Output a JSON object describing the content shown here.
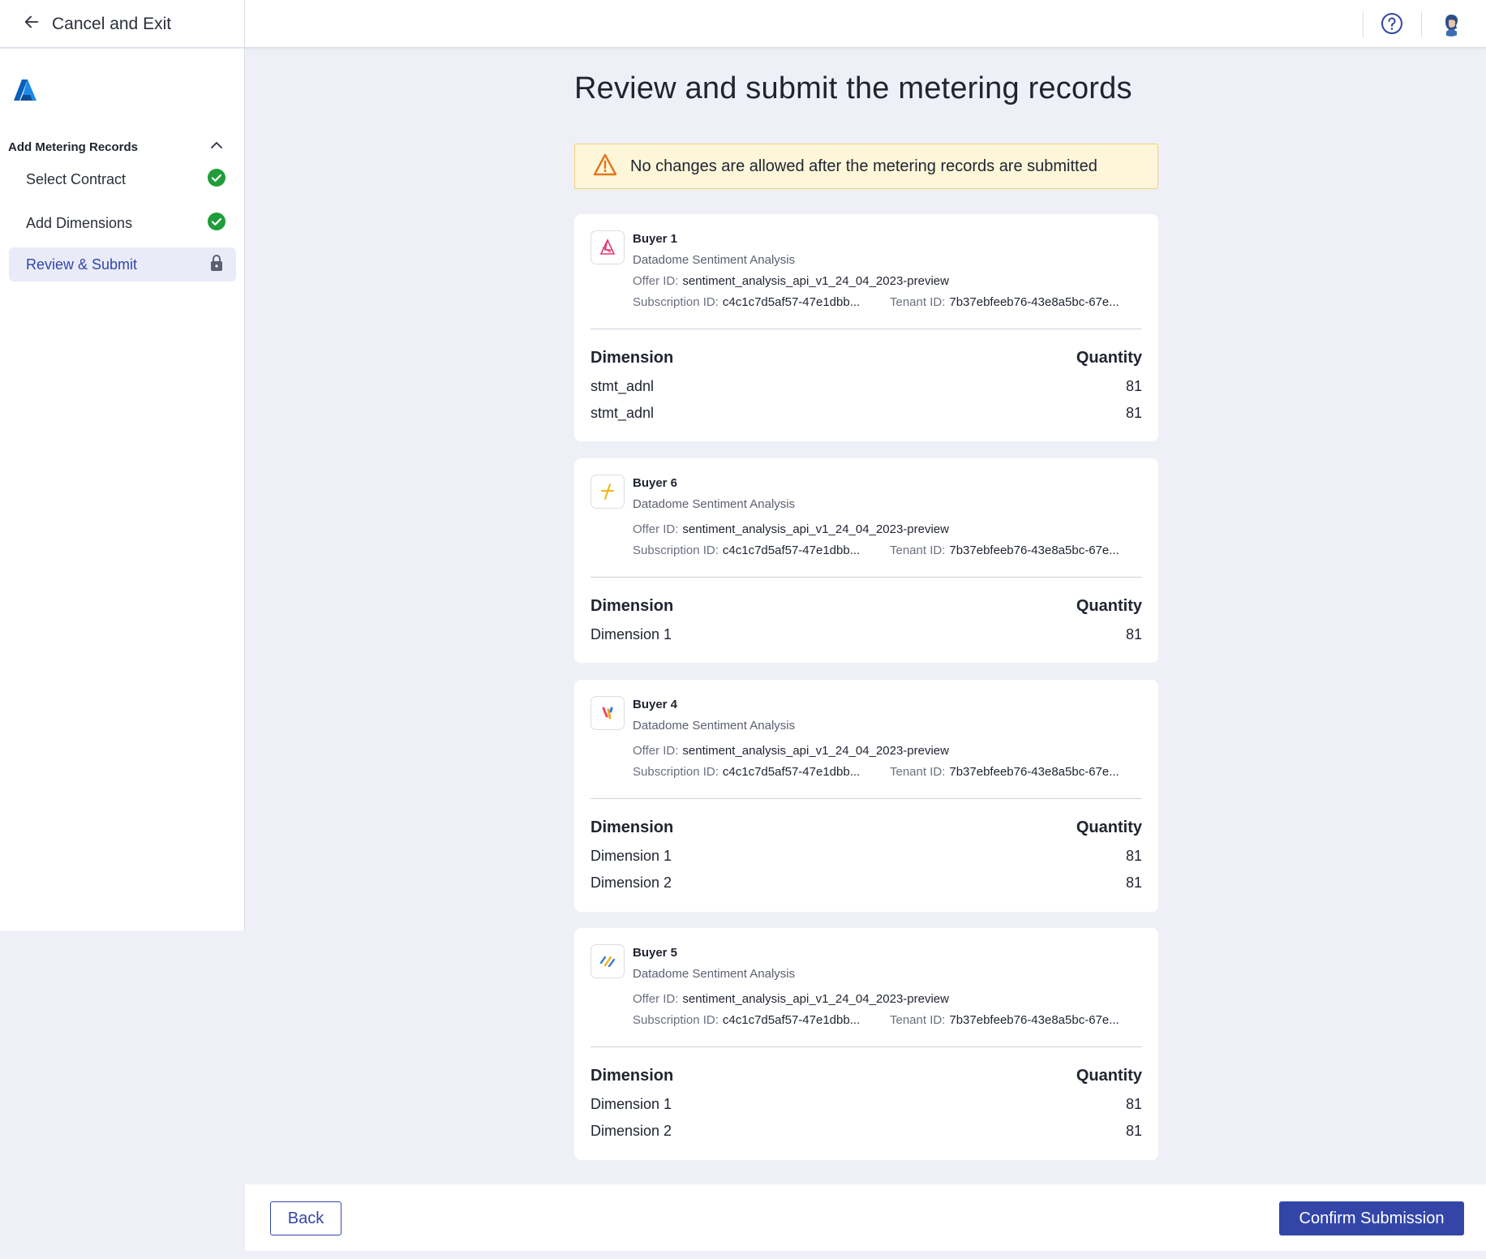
{
  "topbar": {
    "cancel_label": "Cancel and Exit"
  },
  "sidebar": {
    "section_title": "Add Metering Records",
    "steps": [
      {
        "label": "Select Contract",
        "status": "completed",
        "icon": "check-circle-icon"
      },
      {
        "label": "Add Dimensions",
        "status": "completed",
        "icon": "check-circle-icon"
      },
      {
        "label": "Review & Submit",
        "status": "active",
        "icon": "lock-icon"
      }
    ]
  },
  "main": {
    "title": "Review and submit the metering records",
    "warning": "No changes are allowed after the metering records are submitted",
    "labels": {
      "offer_id": "Offer ID:",
      "subscription_id": "Subscription ID:",
      "tenant_id": "Tenant ID:",
      "dimension": "Dimension",
      "quantity": "Quantity"
    },
    "cards": [
      {
        "buyer": "Buyer 1",
        "product": "Datadome Sentiment Analysis",
        "offer_id": "sentiment_analysis_api_v1_24_04_2023-preview",
        "subscription_id": "c4c1c7d5af57-47e1dbb...",
        "tenant_id": "7b37ebfeeb76-43e8a5bc-67e...",
        "logo": "buyer1-logo-icon",
        "rows": [
          {
            "dimension": "stmt_adnl",
            "quantity": "81"
          },
          {
            "dimension": "stmt_adnl",
            "quantity": "81"
          }
        ]
      },
      {
        "buyer": "Buyer 6",
        "product": "Datadome Sentiment Analysis",
        "offer_id": "sentiment_analysis_api_v1_24_04_2023-preview",
        "subscription_id": "c4c1c7d5af57-47e1dbb...",
        "tenant_id": "7b37ebfeeb76-43e8a5bc-67e...",
        "logo": "buyer6-logo-icon",
        "rows": [
          {
            "dimension": "Dimension 1",
            "quantity": "81"
          }
        ]
      },
      {
        "buyer": "Buyer 4",
        "product": "Datadome Sentiment Analysis",
        "offer_id": "sentiment_analysis_api_v1_24_04_2023-preview",
        "subscription_id": "c4c1c7d5af57-47e1dbb...",
        "tenant_id": "7b37ebfeeb76-43e8a5bc-67e...",
        "logo": "buyer4-logo-icon",
        "rows": [
          {
            "dimension": "Dimension 1",
            "quantity": "81"
          },
          {
            "dimension": "Dimension 2",
            "quantity": "81"
          }
        ]
      },
      {
        "buyer": "Buyer 5",
        "product": "Datadome Sentiment Analysis",
        "offer_id": "sentiment_analysis_api_v1_24_04_2023-preview",
        "subscription_id": "c4c1c7d5af57-47e1dbb...",
        "tenant_id": "7b37ebfeeb76-43e8a5bc-67e...",
        "logo": "buyer5-logo-icon",
        "rows": [
          {
            "dimension": "Dimension 1",
            "quantity": "81"
          },
          {
            "dimension": "Dimension 2",
            "quantity": "81"
          }
        ]
      }
    ]
  },
  "footer": {
    "back_label": "Back",
    "confirm_label": "Confirm Submission"
  },
  "colors": {
    "accent": "#3346a8",
    "success": "#1f9d3a",
    "warning_bg": "#fdf6d9",
    "warning_border": "#f1cf7a",
    "page_bg": "#eff0f7"
  }
}
